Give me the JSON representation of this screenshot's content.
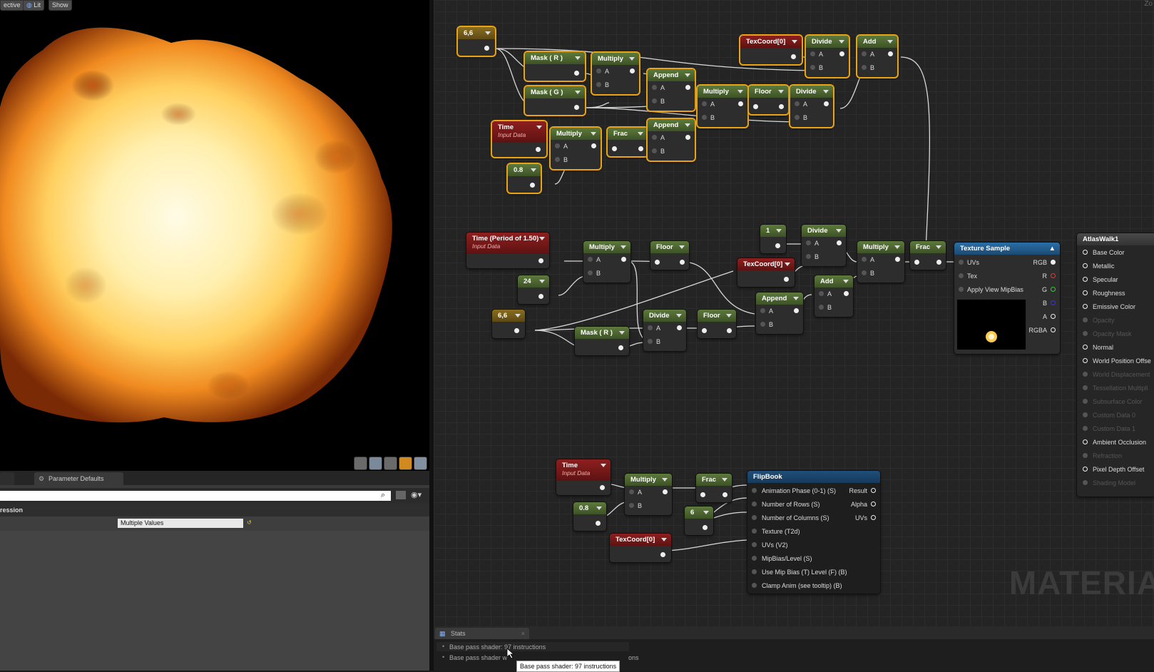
{
  "viewport": {
    "buttons": [
      "ective",
      "Lit",
      "Show"
    ],
    "bottom_icons": [
      "perspective-icon",
      "sphere-icon",
      "plane-icon",
      "cube-icon",
      "mesh-icon"
    ]
  },
  "details": {
    "tab_label": "Parameter Defaults",
    "category": "ression",
    "property_value": "Multiple Values"
  },
  "graph": {
    "nodes": {
      "const66a": {
        "title": "6,6"
      },
      "maskR1": {
        "title": "Mask ( R )"
      },
      "maskG": {
        "title": "Mask ( G )"
      },
      "mult1": {
        "title": "Multiply",
        "a": "A",
        "b": "B"
      },
      "append1": {
        "title": "Append",
        "a": "A",
        "b": "B"
      },
      "mult2": {
        "title": "Multiply",
        "a": "A",
        "b": "B"
      },
      "floor1": {
        "title": "Floor"
      },
      "divide1": {
        "title": "Divide",
        "a": "A",
        "b": "B"
      },
      "texcoord1": {
        "title": "TexCoord[0]"
      },
      "divide2": {
        "title": "Divide",
        "a": "A",
        "b": "B"
      },
      "add1": {
        "title": "Add",
        "a": "A",
        "b": "B"
      },
      "time1": {
        "title": "Time",
        "sub": "Input Data"
      },
      "mult3": {
        "title": "Multiply",
        "a": "A",
        "b": "B"
      },
      "frac1": {
        "title": "Frac"
      },
      "append2": {
        "title": "Append",
        "a": "A",
        "b": "B"
      },
      "const08a": {
        "title": "0.8"
      },
      "timePeriod": {
        "title": "Time (Period of 1.50)",
        "sub": "Input Data"
      },
      "const24": {
        "title": "24"
      },
      "mult4": {
        "title": "Multiply",
        "a": "A",
        "b": "B"
      },
      "floor2": {
        "title": "Floor"
      },
      "const1": {
        "title": "1"
      },
      "divide3": {
        "title": "Divide",
        "a": "A",
        "b": "B"
      },
      "texcoord2": {
        "title": "TexCoord[0]"
      },
      "add2": {
        "title": "Add",
        "a": "A",
        "b": "B"
      },
      "mult5": {
        "title": "Multiply",
        "a": "A",
        "b": "B"
      },
      "frac2": {
        "title": "Frac"
      },
      "const66b": {
        "title": "6,6"
      },
      "maskR2": {
        "title": "Mask ( R )"
      },
      "divide4": {
        "title": "Divide",
        "a": "A",
        "b": "B"
      },
      "floor3": {
        "title": "Floor"
      },
      "append3": {
        "title": "Append",
        "a": "A",
        "b": "B"
      },
      "time3": {
        "title": "Time",
        "sub": "Input Data"
      },
      "mult6": {
        "title": "Multiply",
        "a": "A",
        "b": "B"
      },
      "frac3": {
        "title": "Frac"
      },
      "const08b": {
        "title": "0.8"
      },
      "const6": {
        "title": "6"
      },
      "texcoord3": {
        "title": "TexCoord[0]"
      }
    },
    "texture_sample": {
      "title": "Texture Sample",
      "inputs": [
        "UVs",
        "Tex",
        "Apply View MipBias"
      ],
      "outputs": [
        "RGB",
        "R",
        "G",
        "B",
        "A",
        "RGBA"
      ]
    },
    "flipbook": {
      "title": "FlipBook",
      "inputs": [
        "Animation Phase (0-1) (S)",
        "Number of Rows (S)",
        "Number of Columns (S)",
        "Texture (T2d)",
        "UVs (V2)",
        "MipBias/Level (S)",
        "Use Mip Bias (T) Level (F) (B)",
        "Clamp Anim (see tooltip) (B)"
      ],
      "outputs": [
        "Result",
        "Alpha",
        "UVs"
      ]
    },
    "material": {
      "title": "AtlasWalk1",
      "inputs": [
        {
          "label": "Base Color",
          "active": true
        },
        {
          "label": "Metallic",
          "active": true
        },
        {
          "label": "Specular",
          "active": true
        },
        {
          "label": "Roughness",
          "active": true
        },
        {
          "label": "Emissive Color",
          "active": true
        },
        {
          "label": "Opacity",
          "active": false
        },
        {
          "label": "Opacity Mask",
          "active": false
        },
        {
          "label": "Normal",
          "active": true
        },
        {
          "label": "World Position Offse",
          "active": true
        },
        {
          "label": "World Displacement",
          "active": false
        },
        {
          "label": "Tessellation Multipli",
          "active": false
        },
        {
          "label": "Subsurface Color",
          "active": false
        },
        {
          "label": "Custom Data 0",
          "active": false
        },
        {
          "label": "Custom Data 1",
          "active": false
        },
        {
          "label": "Ambient Occlusion",
          "active": true
        },
        {
          "label": "Refraction",
          "active": false
        },
        {
          "label": "Pixel Depth Offset",
          "active": true
        },
        {
          "label": "Shading Model",
          "active": false
        }
      ]
    },
    "watermark": "MATERIA",
    "corner_label": "Zo"
  },
  "stats": {
    "tab_label": "Stats",
    "line1": "Base pass shader: 97 instructions",
    "line2_left": "Base pass shader w",
    "line2_right": "ons",
    "tooltip": "Base pass shader: 97 instructions"
  }
}
